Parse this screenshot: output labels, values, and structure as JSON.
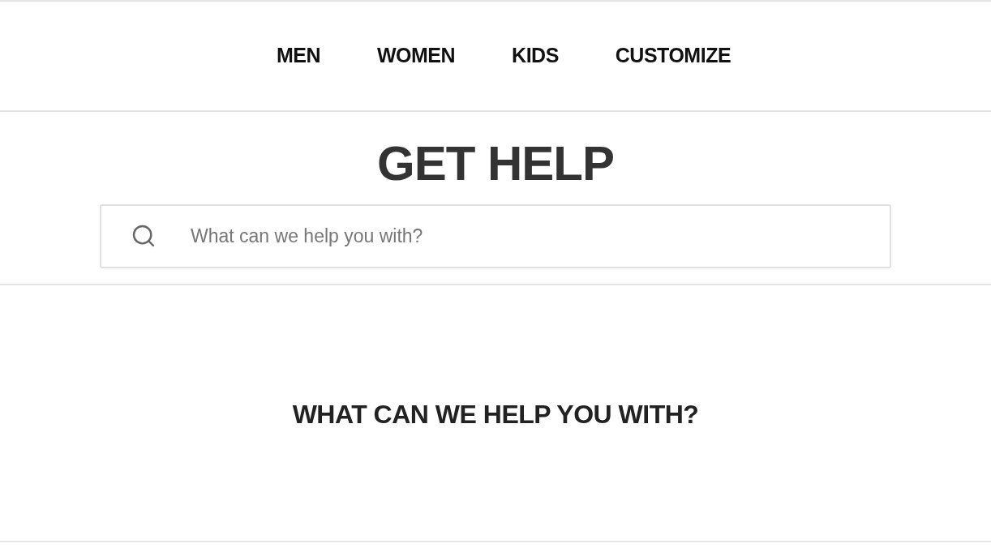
{
  "nav": {
    "items": [
      {
        "label": "MEN"
      },
      {
        "label": "WOMEN"
      },
      {
        "label": "KIDS"
      },
      {
        "label": "CUSTOMIZE"
      }
    ]
  },
  "title": "GET HELP",
  "search": {
    "placeholder": "What can we help you with?"
  },
  "section": {
    "heading": "WHAT CAN WE HELP YOU WITH?"
  }
}
